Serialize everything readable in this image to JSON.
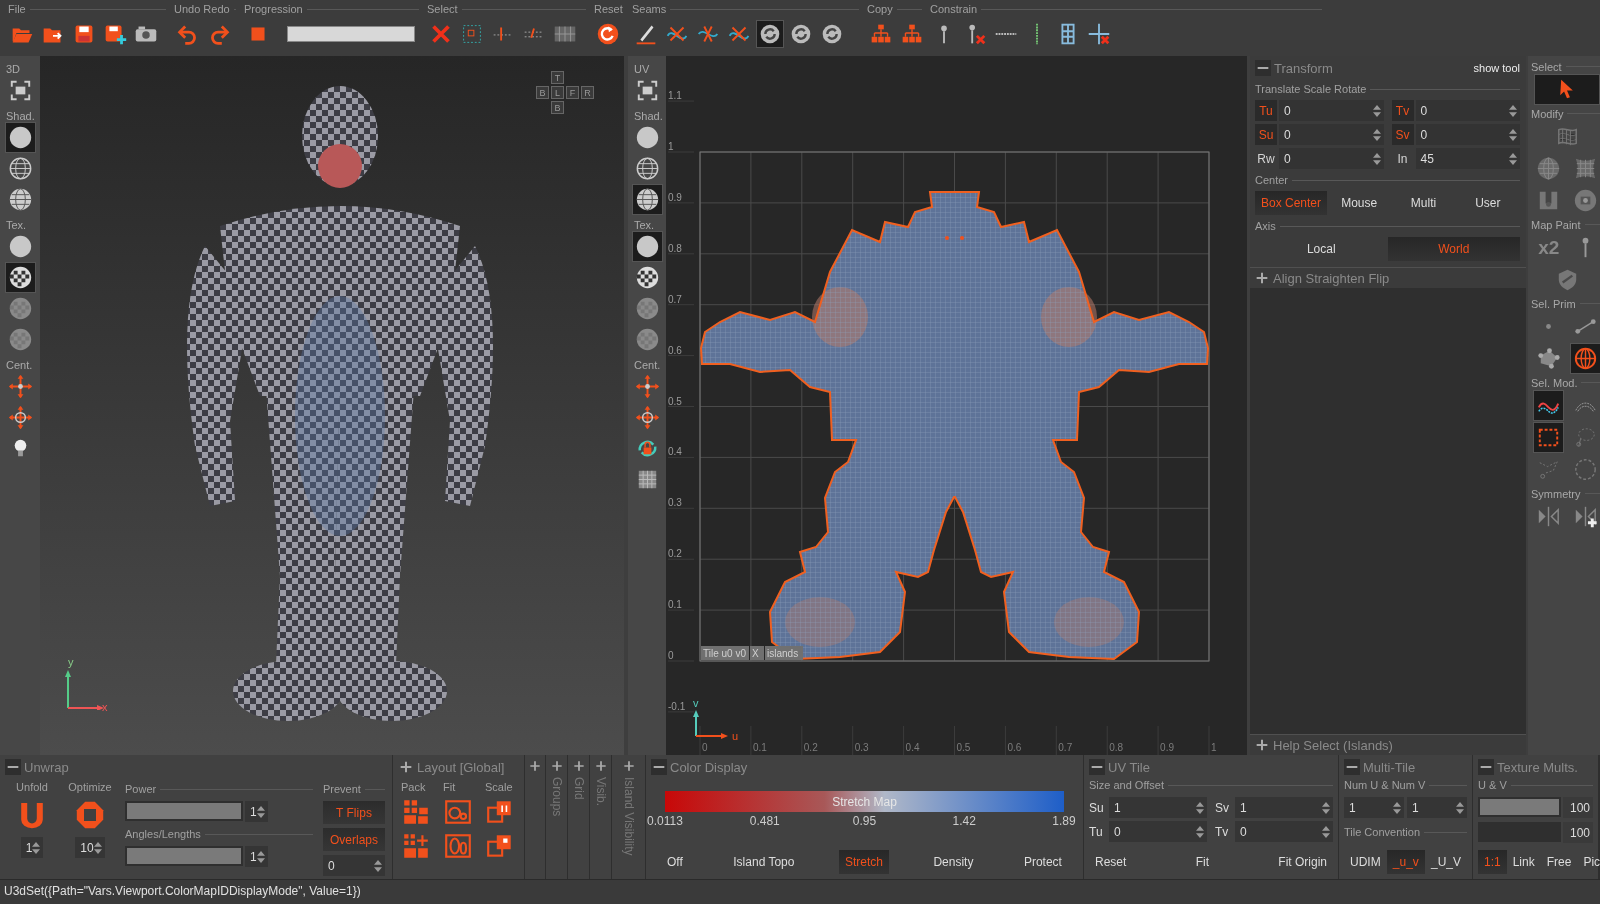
{
  "toolbar": {
    "groups": [
      {
        "label": "File",
        "kind": "buttons",
        "tools": [
          {
            "selected": false
          },
          {
            "selected": false
          },
          {
            "selected": false
          },
          {
            "selected": false
          },
          {
            "selected": false
          }
        ]
      },
      {
        "label": "Undo Redo",
        "kind": "buttons",
        "tools": [
          {
            "selected": false
          },
          {
            "selected": false
          }
        ]
      },
      {
        "label": "Progression",
        "kind": "progress",
        "tools": [
          {
            "selected": false
          }
        ]
      },
      {
        "label": "Select",
        "kind": "buttons",
        "tools": [
          {
            "selected": false
          },
          {
            "selected": false
          },
          {
            "selected": false
          },
          {
            "selected": false
          },
          {
            "selected": false
          }
        ]
      },
      {
        "label": "Reset",
        "kind": "buttons",
        "tools": [
          {
            "selected": false
          }
        ]
      },
      {
        "label": "Seams",
        "kind": "buttons",
        "tools": [
          {
            "selected": false
          },
          {
            "selected": false
          },
          {
            "selected": false
          },
          {
            "selected": false
          },
          {
            "selected": true
          },
          {
            "selected": false
          },
          {
            "selected": false
          }
        ]
      },
      {
        "label": "Copy",
        "kind": "buttons",
        "tools": [
          {
            "selected": false
          },
          {
            "selected": false
          }
        ]
      },
      {
        "label": "Constrain",
        "kind": "buttons",
        "tools": [
          {
            "selected": false
          },
          {
            "selected": false
          },
          {
            "selected": false
          },
          {
            "selected": false
          },
          {
            "selected": false
          },
          {
            "selected": false
          }
        ]
      }
    ]
  },
  "viewport_3d": {
    "toolbar": {
      "sections": [
        {
          "label": "3D",
          "tools": [
            {
              "selected": false
            }
          ]
        },
        {
          "label": "Shad.",
          "tools": [
            {
              "selected": true
            },
            {
              "selected": false
            },
            {
              "selected": false
            }
          ]
        },
        {
          "label": "Tex.",
          "tools": [
            {
              "selected": false
            },
            {
              "selected": true
            },
            {
              "selected": false
            },
            {
              "selected": false
            }
          ]
        },
        {
          "label": "Cent.",
          "tools": [
            {
              "selected": false
            },
            {
              "selected": false
            },
            {
              "selected": false
            }
          ]
        }
      ]
    },
    "view_cube": {
      "top": "T",
      "middle": [
        "B",
        "L",
        "F",
        "R"
      ],
      "bottom": "B"
    },
    "axis_labels": [
      "y",
      "x"
    ]
  },
  "viewport_uv": {
    "toolbar": {
      "sections": [
        {
          "label": "UV",
          "tools": [
            {
              "selected": false
            }
          ]
        },
        {
          "label": "Shad.",
          "tools": [
            {
              "selected": false
            },
            {
              "selected": false
            },
            {
              "selected": true
            }
          ]
        },
        {
          "label": "Tex.",
          "tools": [
            {
              "selected": true
            },
            {
              "selected": false
            },
            {
              "selected": false
            },
            {
              "selected": false
            }
          ]
        },
        {
          "label": "Cent.",
          "tools": [
            {
              "selected": false
            },
            {
              "selected": false
            },
            {
              "selected": false
            },
            {
              "selected": false
            }
          ]
        }
      ]
    },
    "v_ticks": [
      "1.1",
      "1",
      "0.9",
      "0.8",
      "0.7",
      "0.6",
      "0.5",
      "0.4",
      "0.3",
      "0.2",
      "0.1",
      "0",
      "-0.1"
    ],
    "u_ticks": [
      "0",
      "0.1",
      "0.2",
      "0.3",
      "0.4",
      "0.5",
      "0.6",
      "0.7",
      "0.8",
      "0.9",
      "1"
    ],
    "tile_tag": [
      "Tile u0 v0",
      "X",
      "islands"
    ],
    "axis_labels": [
      "v",
      "u"
    ]
  },
  "transform": {
    "title": "Transform",
    "expanded": true,
    "show_tool": "show tool",
    "section": "Translate Scale Rotate",
    "fields": [
      {
        "label": "Tu",
        "value": "0",
        "highlighted": true
      },
      {
        "label": "Tv",
        "value": "0",
        "highlighted": true
      },
      {
        "label": "Su",
        "value": "0",
        "highlighted": true
      },
      {
        "label": "Sv",
        "value": "0",
        "highlighted": true
      },
      {
        "label": "Rw",
        "value": "0",
        "highlighted": false
      },
      {
        "label": "In",
        "value": "45",
        "highlighted": false
      }
    ],
    "center": {
      "label": "Center",
      "options": [
        {
          "label": "Box Center",
          "selected": true
        },
        {
          "label": "Mouse",
          "selected": false
        },
        {
          "label": "Multi",
          "selected": false
        },
        {
          "label": "User",
          "selected": false
        }
      ]
    },
    "axis": {
      "label": "Axis",
      "options": [
        {
          "label": "Local",
          "selected": false
        },
        {
          "label": "World",
          "selected": true
        }
      ]
    },
    "sub_panel": {
      "title": "Align Straighten Flip",
      "expanded": false
    },
    "help_panel": {
      "title": "Help Select (Islands)",
      "expanded": false
    }
  },
  "tool_strip": {
    "sections": [
      {
        "label": "Select",
        "tools": [
          {
            "selected": true
          }
        ]
      },
      {
        "label": "Modify",
        "tools": [
          {
            "selected": false
          },
          {
            "selected": false
          },
          {
            "selected": false
          },
          {
            "selected": false
          },
          {
            "selected": false
          }
        ]
      },
      {
        "label": "Map Paint",
        "tools": [
          {
            "text": "x2",
            "selected": false
          },
          {
            "selected": false
          },
          {
            "selected": false
          }
        ]
      },
      {
        "label": "Sel. Prim",
        "tools": [
          {
            "selected": false
          },
          {
            "selected": false
          },
          {
            "selected": false
          },
          {
            "selected": true
          }
        ]
      },
      {
        "label": "Sel. Mod.",
        "tools": [
          {
            "selected": true
          },
          {
            "selected": false
          },
          {
            "selected": true
          },
          {
            "selected": false
          },
          {
            "selected": false
          },
          {
            "selected": false
          }
        ]
      },
      {
        "label": "Symmetry",
        "tools": [
          {
            "selected": false
          },
          {
            "selected": false
          }
        ]
      }
    ]
  },
  "bottom": {
    "unwrap": {
      "title": "Unwrap",
      "expanded": true,
      "unfold": {
        "label": "Unfold",
        "value": "1"
      },
      "optimize": {
        "label": "Optimize",
        "value": "10"
      },
      "power": {
        "label": "Power",
        "level": 1,
        "value": "1"
      },
      "angles": {
        "label": "Angles/Lengths",
        "level": 1,
        "value": "1"
      },
      "prevent": {
        "label": "Prevent",
        "toggles": [
          {
            "label": "T Flips",
            "on": true
          },
          {
            "label": "Overlaps",
            "on": true
          }
        ],
        "value": "0"
      }
    },
    "layout": {
      "title": "Layout [Global]",
      "expanded": false,
      "columns": [
        "Pack",
        "Fit",
        "Scale"
      ]
    },
    "collapsed_panels": [
      {
        "title": "Groups"
      },
      {
        "title": "Grid"
      },
      {
        "title": "Visib."
      },
      {
        "title": "Island Visibility"
      }
    ],
    "color_display": {
      "title": "Color Display",
      "expanded": true,
      "scale_title": "Stretch Map",
      "ticks": [
        "0.0113",
        "0.481",
        "0.95",
        "1.42",
        "1.89"
      ],
      "options": [
        {
          "label": "Off",
          "selected": false
        },
        {
          "label": "Island Topo",
          "selected": false
        },
        {
          "label": "Stretch",
          "selected": true
        },
        {
          "label": "Density",
          "selected": false
        },
        {
          "label": "Protect",
          "selected": false
        }
      ]
    },
    "uv_tile": {
      "title": "UV Tile",
      "expanded": true,
      "section": "Size and Offset",
      "fields": [
        {
          "label": "Su",
          "value": "1"
        },
        {
          "label": "Sv",
          "value": "1"
        },
        {
          "label": "Tu",
          "value": "0"
        },
        {
          "label": "Tv",
          "value": "0"
        }
      ],
      "buttons": [
        "Reset",
        "Fit",
        "Fit Origin"
      ]
    },
    "multi_tile": {
      "title": "Multi-Tile",
      "expanded": true,
      "section": "Num U & Num V",
      "values": [
        "1",
        "1"
      ],
      "convention_label": "Tile Convention",
      "options": [
        {
          "label": "UDIM",
          "selected": false
        },
        {
          "label": "_u_v",
          "selected": true
        },
        {
          "label": "_U_V",
          "selected": false
        }
      ]
    },
    "texture_mults": {
      "title": "Texture Mults.",
      "expanded": true,
      "section": "U & V",
      "sliders": [
        {
          "level": 1,
          "value": "100"
        },
        {
          "value": "100"
        }
      ],
      "options": [
        {
          "label": "1:1",
          "selected": true
        },
        {
          "label": "Link",
          "selected": false
        },
        {
          "label": "Free",
          "selected": false
        },
        {
          "label": "Pic",
          "selected": false
        }
      ]
    }
  },
  "status_bar": {
    "message": "U3dSet({Path=\"Vars.Viewport.ColorMapIDDisplayMode\", Value=1})"
  }
}
